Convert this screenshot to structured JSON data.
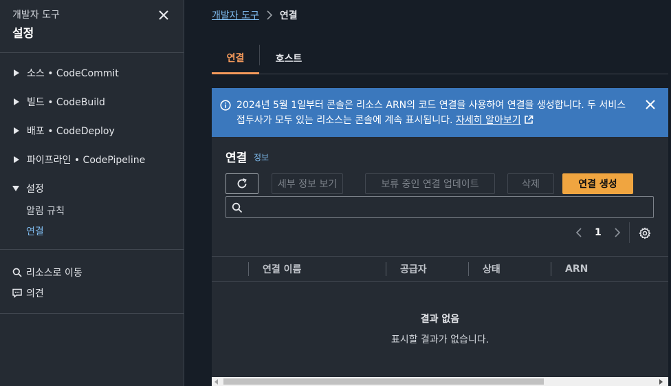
{
  "sidebar": {
    "super_title": "개발자 도구",
    "title": "설정",
    "groups": [
      {
        "label": "소스 • CodeCommit"
      },
      {
        "label": "빌드 • CodeBuild"
      },
      {
        "label": "배포 • CodeDeploy"
      },
      {
        "label": "파이프라인 • CodePipeline"
      },
      {
        "label": "설정",
        "expanded": true
      }
    ],
    "settings_items": [
      {
        "label": "알림 규칙",
        "active": false
      },
      {
        "label": "연결",
        "active": true
      }
    ],
    "links": [
      {
        "label": "리소스로 이동",
        "icon": "search-icon"
      },
      {
        "label": "의견",
        "icon": "feedback-icon"
      }
    ]
  },
  "breadcrumb": {
    "root": "개발자 도구",
    "current": "연결"
  },
  "tabs": [
    {
      "label": "연결",
      "active": true
    },
    {
      "label": "호스트",
      "active": false
    }
  ],
  "flash": {
    "message": "2024년 5월 1일부터 콘솔은 리소스 ARN의 코드 연결을 사용하여 연결을 생성합니다. 두 서비스 접두사가 모두 있는 리소스는 콘솔에 계속 표시됩니다.",
    "link_label": "자세히 알아보기",
    "color": "#3b78bd"
  },
  "section": {
    "title": "연결",
    "info": "정보"
  },
  "toolbar": {
    "refresh_icon": "refresh-icon",
    "detail_label": "세부 정보 보기",
    "update_label": "보류 중인 연결 업데이트",
    "delete_label": "삭제",
    "create_label": "연결 생성"
  },
  "search": {
    "value": "",
    "placeholder": ""
  },
  "pagination": {
    "current_page": "1"
  },
  "table": {
    "columns": [
      "연결 이름",
      "공급자",
      "상태",
      "ARN"
    ],
    "rows": []
  },
  "empty": {
    "title": "결과 없음",
    "description": "표시할 결과가 없습니다."
  },
  "colors": {
    "accent": "#f59a5b",
    "link": "#7fbcf0",
    "primary_button": "#f0a540"
  }
}
